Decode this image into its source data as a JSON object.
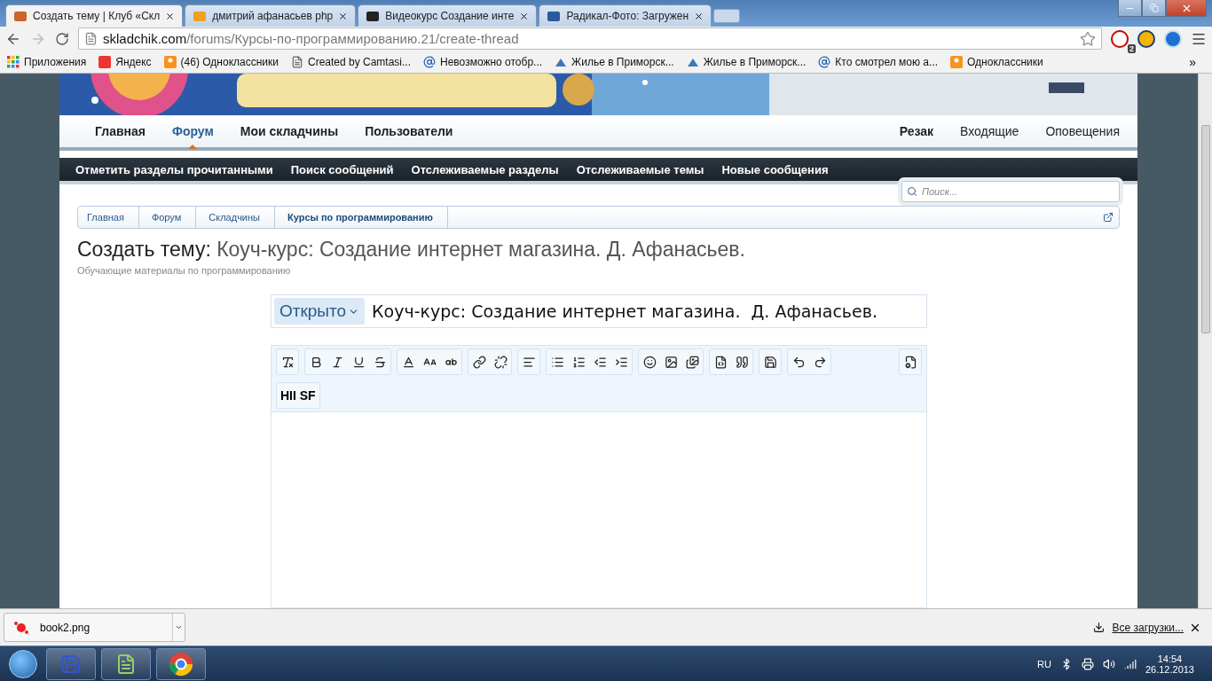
{
  "browser": {
    "tabs": [
      {
        "title": "Создать тему | Клуб «Скл",
        "selected": true
      },
      {
        "title": "дмитрий афанасьев php",
        "selected": false
      },
      {
        "title": "Видеокурс Создание инте",
        "selected": false
      },
      {
        "title": "Радикал-Фото: Загружен",
        "selected": false
      }
    ],
    "url": {
      "host": "skladchik.com",
      "path": "/forums/Курсы-по-программированию.21/create-thread"
    },
    "extension_badge": "2",
    "bookmarks": [
      "Приложения",
      "Яндекс",
      "(46) Одноклассники",
      "Created by Camtasi...",
      "Невозможно отобр...",
      "Жилье в Приморск...",
      "Жилье в Приморск...",
      "Кто смотрел мою а...",
      "Одноклассники"
    ],
    "bookmarks_overflow": "»"
  },
  "site": {
    "nav": [
      {
        "label": "Главная",
        "selected": false
      },
      {
        "label": "Форум",
        "selected": true
      },
      {
        "label": "Мои складчины",
        "selected": false
      },
      {
        "label": "Пользователи",
        "selected": false
      }
    ],
    "user_nav": [
      {
        "label": "Резак",
        "bold": true
      },
      {
        "label": "Входящие",
        "bold": false
      },
      {
        "label": "Оповещения",
        "bold": false
      }
    ],
    "sub_nav": [
      "Отметить разделы прочитанными",
      "Поиск сообщений",
      "Отслеживаемые разделы",
      "Отслеживаемые темы",
      "Новые сообщения"
    ],
    "search": {
      "placeholder": "Поиск..."
    },
    "breadcrumbs": [
      "Главная",
      "Форум",
      "Складчины",
      "Курсы по программированию"
    ],
    "heading": {
      "prefix": "Создать тему:",
      "title": "Коуч-курс: Создание интернет магазина. Д. Афанасьев."
    },
    "subheading": "Обучающие материалы по программированию",
    "thread_prefix": "Открыто",
    "thread_title": "Коуч-курс: Создание интернет магазина.  Д. Афанасьев.",
    "editor_extra_button": "HII SF"
  },
  "download_bar": {
    "file": "book2.png",
    "all_link": "Все загрузки..."
  },
  "taskbar": {
    "language": "RU",
    "time": "14:54",
    "date": "26.12.2013"
  }
}
